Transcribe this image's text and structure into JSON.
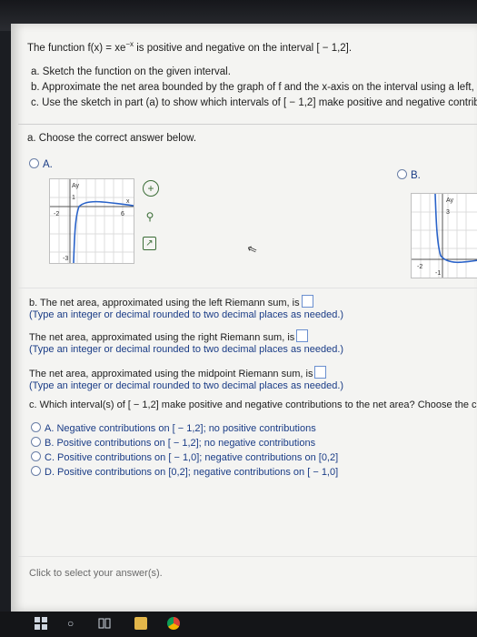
{
  "problem": {
    "intro": "The function f(x) = xe",
    "intro_sup": "−x",
    "intro_rest": " is positive and negative on the interval [ − 1,2].",
    "part_a": "a. Sketch the function on the given interval.",
    "part_b": "b. Approximate the net area bounded by the graph of f and the x-axis on the interval using a left, r",
    "part_c": "c. Use the sketch in part (a) to show which intervals of [ − 1,2] make positive and negative contribu"
  },
  "question_a": {
    "prompt": "a. Choose the correct answer below.",
    "option_a": "A.",
    "option_b": "B.",
    "graph_a_ticks": {
      "y_top": "1",
      "y_bottom": "-3",
      "x_left": "-2",
      "x_right": "6",
      "x_axis": "x",
      "y_axis": "Ay"
    },
    "graph_b_ticks": {
      "y_top": "3",
      "y_bottom": "-1",
      "x_left": "-2",
      "y_axis": "Ay"
    }
  },
  "question_b": {
    "left_label": "b. The net area, approximated using the left Riemann sum, is",
    "left_hint": "(Type an integer or decimal rounded to two decimal places as needed.)",
    "right_label": "The net area, approximated using the right Riemann sum, is",
    "right_hint": "(Type an integer or decimal rounded to two decimal places as needed.)",
    "mid_label": "The net area, approximated using the midpoint Riemann sum, is",
    "mid_hint": "(Type an integer or decimal rounded to two decimal places as needed.)"
  },
  "question_c": {
    "prompt": "c. Which interval(s) of [ − 1,2] make positive and negative contributions to the net area? Choose the corre",
    "options": [
      "A.  Negative contributions on [ − 1,2]; no positive contributions",
      "B.  Positive contributions on [ − 1,2]; no negative contributions",
      "C.  Positive contributions on [ − 1,0]; negative contributions on [0,2]",
      "D.  Positive contributions on [0,2]; negative contributions on [ − 1,0]"
    ]
  },
  "footer": {
    "hint": "Click to select your answer(s)."
  },
  "colors": {
    "link_blue": "#1a3c86",
    "curve_blue": "#2a63c9",
    "zoom_green": "#3b6d37"
  }
}
